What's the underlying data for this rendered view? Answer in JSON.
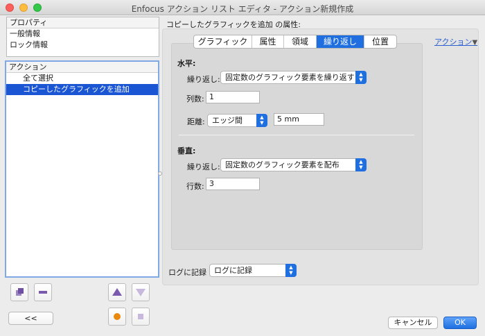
{
  "window": {
    "title": "Enfocus アクション リスト エディタ - アクション新規作成"
  },
  "properties_panel": {
    "header": "プロパティ",
    "items": [
      "一般情報",
      "ロック情報"
    ]
  },
  "actions_panel": {
    "header": "アクション",
    "items": [
      {
        "label": "全て選択",
        "selected": false
      },
      {
        "label": "コピーしたグラフィックを追加",
        "selected": true
      }
    ]
  },
  "left_buttons": {
    "back_label": "<<",
    "icons": [
      "duplicate-icon",
      "remove-icon",
      "move-up-icon",
      "move-down-icon",
      "record-icon",
      "stop-icon"
    ]
  },
  "content": {
    "title": "コピーしたグラフィックを追加 の属性:",
    "action_link": "アクション",
    "tabs": [
      {
        "label": "グラフィック",
        "active": false
      },
      {
        "label": "属性",
        "active": false
      },
      {
        "label": "領域",
        "active": false
      },
      {
        "label": "繰り返し",
        "active": true
      },
      {
        "label": "位置",
        "active": false
      }
    ],
    "horizontal": {
      "heading": "水平:",
      "repeat_label": "繰り返し:",
      "repeat_value": "固定数のグラフィック要素を繰り返す",
      "columns_label": "列数:",
      "columns_value": "1",
      "distance_label": "距離:",
      "distance_mode": "エッジ間",
      "distance_value": "5 mm"
    },
    "vertical": {
      "heading": "垂直:",
      "repeat_label": "繰り返し:",
      "repeat_value": "固定数のグラフィック要素を配布",
      "rows_label": "行数:",
      "rows_value": "3"
    },
    "log_label": "ログに記録",
    "log_value": "ログに記録"
  },
  "footer": {
    "cancel_label": "キャンセル",
    "ok_label": "OK"
  },
  "colors": {
    "accent": "#1f6fe0",
    "selection": "#1a55d4",
    "link": "#2a5fcf",
    "record": "#e8890e",
    "purple_icon": "#8b6bb8"
  }
}
